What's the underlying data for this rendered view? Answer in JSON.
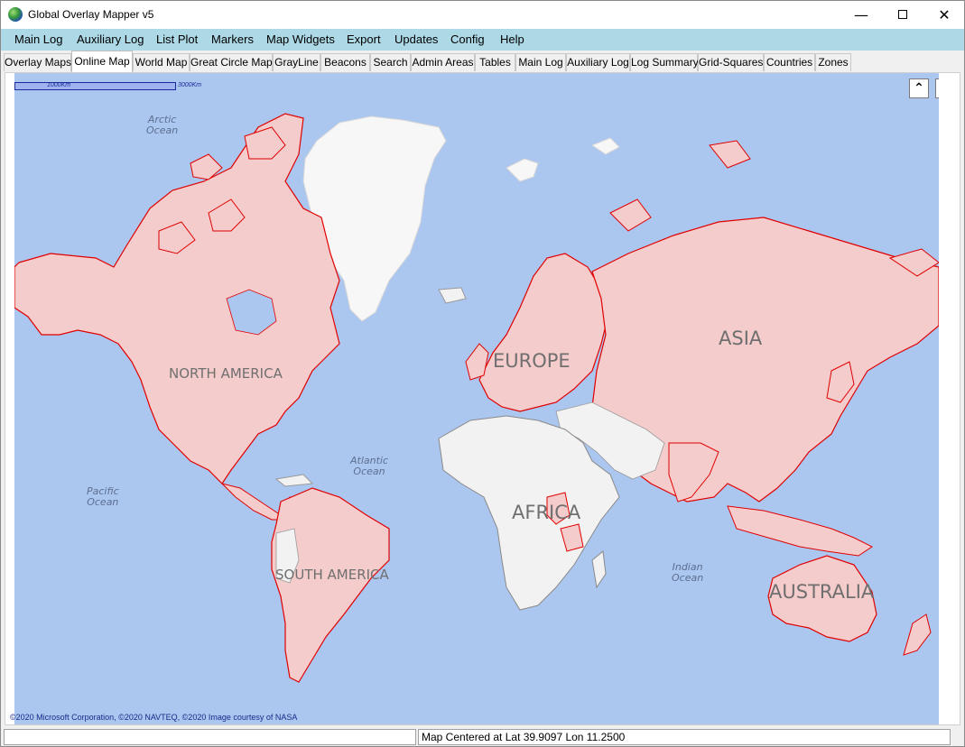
{
  "window": {
    "title": "Global Overlay Mapper v5",
    "minimize": "—",
    "close": "✕"
  },
  "menu": [
    "Main Log",
    "Auxiliary Log",
    "List Plot",
    "Markers",
    "Map Widgets",
    "Export",
    "Updates",
    "Config",
    "Help"
  ],
  "tabs": [
    {
      "label": "Overlay Maps",
      "active": false
    },
    {
      "label": "Online Map",
      "active": true
    },
    {
      "label": "World Map",
      "active": false
    },
    {
      "label": "Great Circle Map",
      "active": false
    },
    {
      "label": "GrayLine",
      "active": false
    },
    {
      "label": "Beacons",
      "active": false
    },
    {
      "label": "Search",
      "active": false
    },
    {
      "label": "Admin Areas",
      "active": false
    },
    {
      "label": "Tables",
      "active": false
    },
    {
      "label": "Main Log",
      "active": false
    },
    {
      "label": "Auxiliary Log",
      "active": false
    },
    {
      "label": "Log Summary",
      "active": false
    },
    {
      "label": "Grid-Squares",
      "active": false
    },
    {
      "label": "Countries",
      "active": false
    },
    {
      "label": "Zones",
      "active": false
    }
  ],
  "map": {
    "scale": {
      "label_1": "1000Km",
      "label_2": "3000Km"
    },
    "zoom_in_icon": "chevron-up-icon",
    "zoom_out_icon": "chevron-down-icon",
    "oceans": {
      "arctic": [
        "Arctic",
        "Ocean"
      ],
      "atlantic": [
        "Atlantic",
        "Ocean"
      ],
      "pacific": [
        "Pacific",
        "Ocean"
      ],
      "indian": [
        "Indian",
        "Ocean"
      ]
    },
    "continents": {
      "north_america": "NORTH AMERICA",
      "south_america": "SOUTH AMERICA",
      "europe": "EUROPE",
      "africa": "AFRICA",
      "asia": "ASIA",
      "australia": "AUSTRALIA"
    },
    "colors": {
      "ocean": "#abc6ef",
      "highlight_fill": "#f5cccc",
      "highlight_border": "#e00000",
      "land_gray": "#f2f2f2",
      "ice": "#f7f7f7"
    },
    "attribution": "©2020 Microsoft Corporation, ©2020 NAVTEQ, ©2020 Image courtesy of NASA"
  },
  "status": {
    "left": "",
    "right": "Map Centered at Lat 39.9097  Lon 11.2500"
  }
}
